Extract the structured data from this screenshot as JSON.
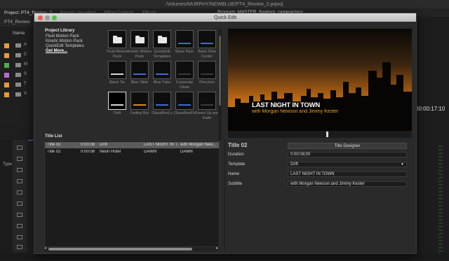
{
  "os": {
    "window_path": "/Volumes/MURPHY/NEWBLUE/PT4_Review_2.prproj"
  },
  "premiere": {
    "tabs": [
      "Project: PT4_Review_2",
      "Source: (no clips)",
      "Effect Controls",
      "Effects"
    ],
    "program_label": "Program: MASTER_finalproj_cameraclass",
    "project_name": "PT4_Review",
    "name_column": "Name",
    "list_rows": [
      "A",
      "C",
      "M",
      "S",
      "T",
      "V"
    ],
    "timecode": "00:00:17:10",
    "type_label": "Type"
  },
  "quick_edit": {
    "window_title": "Quick Edit",
    "library": {
      "label": "Project Library",
      "items": [
        "Fluid Motion Pack",
        "Kinetic Motion Pack",
        "QuickEdit Templates"
      ],
      "more": "Get More..."
    },
    "templates": [
      {
        "label": "Fluid Motion Pack",
        "kind": "folder"
      },
      {
        "label": "Kinetic Motion Pack",
        "kind": "folder"
      },
      {
        "label": "QuickEdit Templates",
        "kind": "folder"
      },
      {
        "label": "Basic Blue",
        "kind": "blue"
      },
      {
        "label": "Basic Blue Center",
        "kind": "blue"
      },
      {
        "label": "Black Tie",
        "kind": "white"
      },
      {
        "label": "Blue Slide",
        "kind": "blue"
      },
      {
        "label": "Blue Tube",
        "kind": "blue"
      },
      {
        "label": "Corporate Clean",
        "kind": "dark"
      },
      {
        "label": "Direction",
        "kind": "dark"
      },
      {
        "label": "Drift",
        "kind": "white",
        "selected": true
      },
      {
        "label": "Fading Bar",
        "kind": "orange"
      },
      {
        "label": "GlassBoxLo",
        "kind": "blue"
      },
      {
        "label": "GlassBoxFh",
        "kind": "blue"
      },
      {
        "label": "Green Up and Fade",
        "kind": "dark"
      }
    ],
    "preview": {
      "title": "LAST NIGHT IN TOWN",
      "subtitle": "with Morgan Newson and Jimmy Kester"
    },
    "title_list": {
      "label": "Title List",
      "rows": [
        {
          "name": "Title 02",
          "duration": "0:00:08",
          "template": "Drift",
          "line1": "LAST NIGHT IN T...",
          "line2": "with Morgan New...",
          "selected": true
        },
        {
          "name": "Title 02",
          "duration": "0:00:08",
          "template": "Neon Hotel",
          "line1": "DAWN",
          "line2": "DAMN",
          "selected": false
        }
      ]
    },
    "properties": {
      "title": "Title 02",
      "designer_button": "Title Designer",
      "duration_label": "Duration",
      "duration_value": "0:00:08;00",
      "template_label": "Template",
      "template_value": "Drift",
      "name_label": "Name",
      "name_value": "LAST NIGHT IN TOWN",
      "subtitle_label": "Subtitle",
      "subtitle_value": "with Morgan Newson and Jimmy Kester"
    },
    "accent_colors": {
      "sky_orange": "#e08a1e",
      "subtitle_orange": "#f0a020",
      "timeline_blue": "#3f7fd8"
    }
  }
}
